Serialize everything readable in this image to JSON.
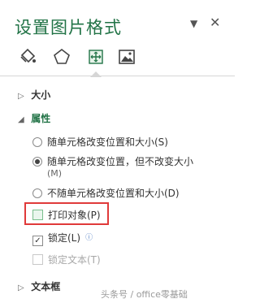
{
  "pane": {
    "title": "设置图片格式",
    "dropdown_glyph": "▼",
    "close_glyph": "✕"
  },
  "tabs": [
    {
      "name": "fill-line-icon"
    },
    {
      "name": "effects-icon"
    },
    {
      "name": "size-properties-icon",
      "active": true
    },
    {
      "name": "picture-icon"
    }
  ],
  "sections": {
    "size": {
      "label": "大小",
      "chevron": "▷"
    },
    "properties": {
      "label": "属性",
      "chevron": "◢"
    },
    "textbox": {
      "label": "文本框",
      "chevron": "▷"
    }
  },
  "properties": {
    "radio1": {
      "label": "随单元格改变位置和大小(S)",
      "checked": false
    },
    "radio2": {
      "label": "随单元格改变位置，但不改变大小",
      "sub": "(M)",
      "checked": true
    },
    "radio3": {
      "label": "不随单元格改变位置和大小(D)",
      "checked": false
    },
    "print": {
      "label": "打印对象(P)",
      "checked": false
    },
    "locked": {
      "label": "锁定(L)",
      "checked": true
    },
    "lock_text": {
      "label": "锁定文本(T)",
      "checked": false,
      "disabled": true
    }
  },
  "info_glyph": "ⓘ",
  "watermark": "头条号 / office零基础"
}
